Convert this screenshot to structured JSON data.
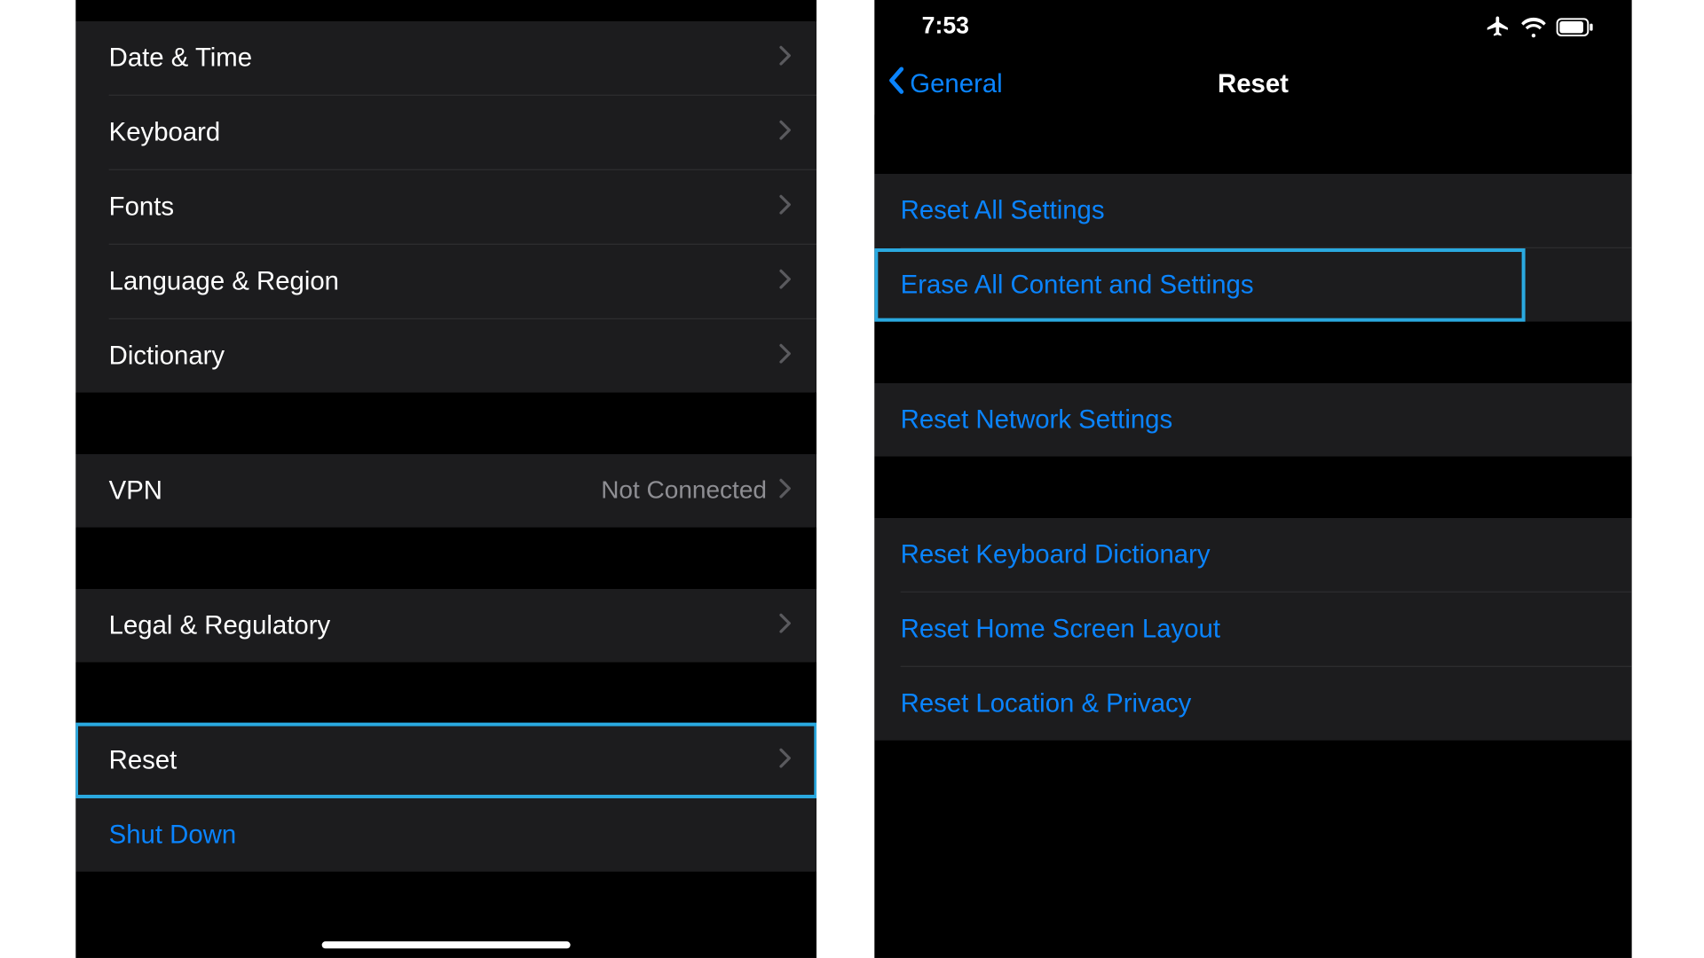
{
  "colors": {
    "accent": "#0a84ff",
    "highlight": "#2aa9e0",
    "cellBg": "#1c1c1e",
    "separator": "#2c2c2e",
    "secondaryText": "#8e8e93"
  },
  "left": {
    "groups": [
      {
        "rows": [
          {
            "id": "date-time",
            "label": "Date & Time"
          },
          {
            "id": "keyboard",
            "label": "Keyboard"
          },
          {
            "id": "fonts",
            "label": "Fonts"
          },
          {
            "id": "language",
            "label": "Language & Region"
          },
          {
            "id": "dictionary",
            "label": "Dictionary"
          }
        ]
      },
      {
        "rows": [
          {
            "id": "vpn",
            "label": "VPN",
            "value": "Not Connected"
          }
        ]
      },
      {
        "rows": [
          {
            "id": "legal",
            "label": "Legal & Regulatory"
          }
        ]
      },
      {
        "rows": [
          {
            "id": "reset",
            "label": "Reset",
            "highlight": true
          },
          {
            "id": "shutdown",
            "label": "Shut Down",
            "blue": true,
            "noChevron": true
          }
        ]
      }
    ]
  },
  "right": {
    "status": {
      "time": "7:53"
    },
    "nav": {
      "back": "General",
      "title": "Reset"
    },
    "groups": [
      {
        "rows": [
          {
            "id": "reset-all",
            "label": "Reset All Settings"
          },
          {
            "id": "erase-all",
            "label": "Erase All Content and Settings",
            "highlight": true
          }
        ]
      },
      {
        "rows": [
          {
            "id": "reset-network",
            "label": "Reset Network Settings"
          }
        ]
      },
      {
        "rows": [
          {
            "id": "reset-keyboard-dict",
            "label": "Reset Keyboard Dictionary"
          },
          {
            "id": "reset-home-layout",
            "label": "Reset Home Screen Layout"
          },
          {
            "id": "reset-location",
            "label": "Reset Location & Privacy"
          }
        ]
      }
    ]
  }
}
